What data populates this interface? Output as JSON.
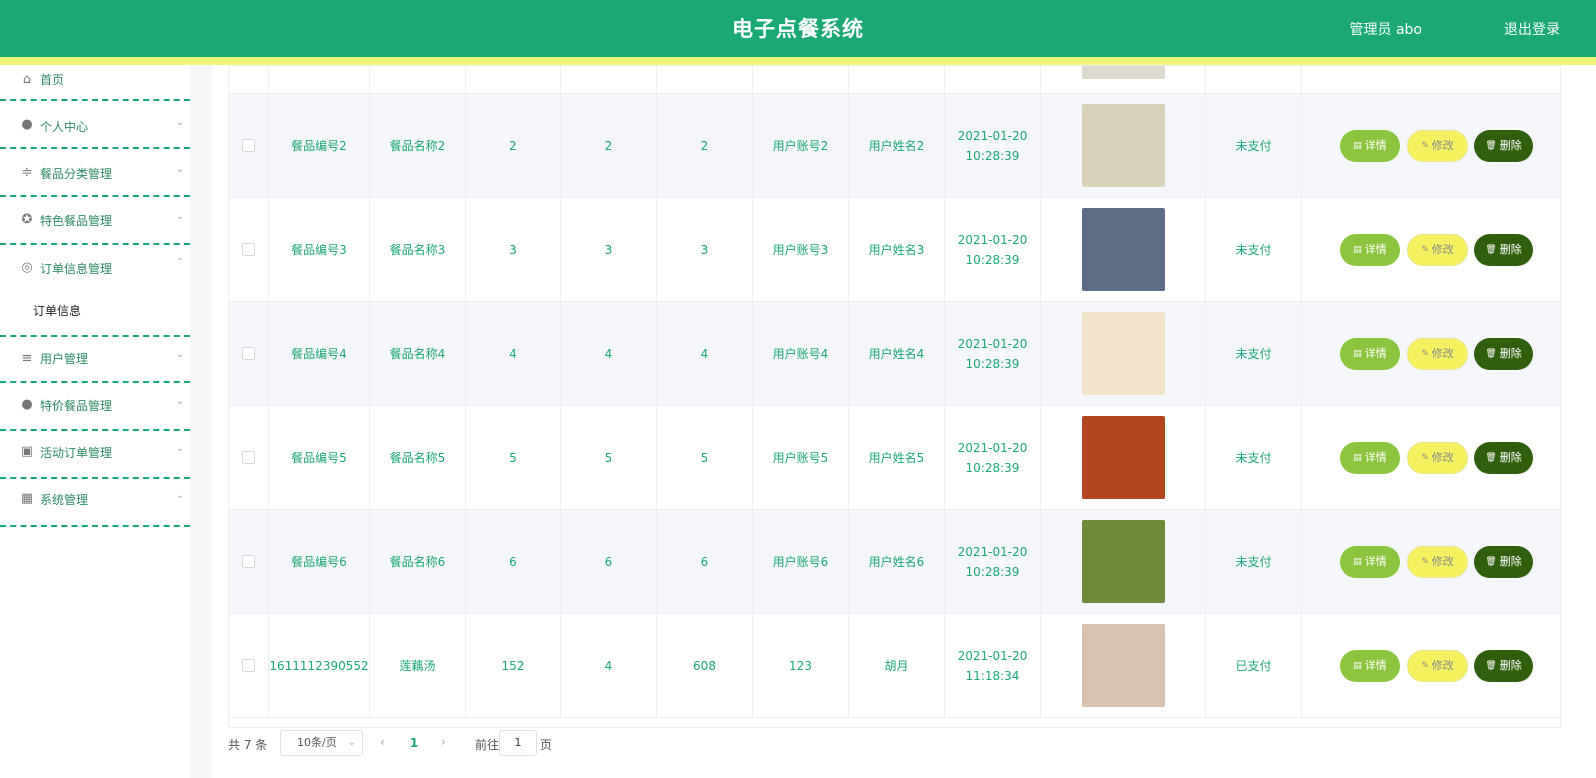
{
  "header": {
    "title": "电子点餐系统",
    "user_label": "管理员 abo",
    "logout_label": "退出登录"
  },
  "sidebar": {
    "items": [
      {
        "label": "首页",
        "icon": "home-icon"
      },
      {
        "label": "个人中心",
        "icon": "user-icon"
      },
      {
        "label": "餐品分类管理",
        "icon": "sliders-icon"
      },
      {
        "label": "特色餐品管理",
        "icon": "compass-icon"
      },
      {
        "label": "订单信息管理",
        "icon": "lifebuoy-icon"
      },
      {
        "label": "用户管理",
        "icon": "menu-icon"
      },
      {
        "label": "特价餐品管理",
        "icon": "location-icon"
      },
      {
        "label": "活动订单管理",
        "icon": "clipboard-icon"
      },
      {
        "label": "系统管理",
        "icon": "grid-icon"
      }
    ],
    "submenu": {
      "label": "订单信息"
    }
  },
  "table": {
    "rows": [
      {
        "code": "餐品编号2",
        "name": "餐品名称2",
        "price": "2",
        "qty": "2",
        "total": "2",
        "account": "用户账号2",
        "username": "用户姓名2",
        "time": "2021-01-20 10:28:39",
        "status": "未支付",
        "image": "salad plate",
        "thumb_color": "#d9d2bb"
      },
      {
        "code": "餐品编号3",
        "name": "餐品名称3",
        "price": "3",
        "qty": "3",
        "total": "3",
        "account": "用户账号3",
        "username": "用户姓名3",
        "time": "2021-01-20 10:28:39",
        "status": "未支付",
        "image": "salmon dish",
        "thumb_color": "#5c6c86"
      },
      {
        "code": "餐品编号4",
        "name": "餐品名称4",
        "price": "4",
        "qty": "4",
        "total": "4",
        "account": "用户账号4",
        "username": "用户姓名4",
        "time": "2021-01-20 10:28:39",
        "status": "未支付",
        "image": "fried egg",
        "thumb_color": "#f1e3c9"
      },
      {
        "code": "餐品编号5",
        "name": "餐品名称5",
        "price": "5",
        "qty": "5",
        "total": "5",
        "account": "用户账号5",
        "username": "用户姓名5",
        "time": "2021-01-20 10:28:39",
        "status": "未支付",
        "image": "shrimp",
        "thumb_color": "#b3461f"
      },
      {
        "code": "餐品编号6",
        "name": "餐品名称6",
        "price": "6",
        "qty": "6",
        "total": "6",
        "account": "用户账号6",
        "username": "用户姓名6",
        "time": "2021-01-20 10:28:39",
        "status": "未支付",
        "image": "skewers",
        "thumb_color": "#6e8a3a"
      },
      {
        "code": "1611112390552",
        "name": "莲藕汤",
        "price": "152",
        "qty": "4",
        "total": "608",
        "account": "123",
        "username": "胡月",
        "time": "2021-01-20 11:18:34",
        "status": "已支付",
        "image": "lotus root soup",
        "thumb_color": "#d8c1ae"
      }
    ],
    "actions": {
      "detail": "详情",
      "edit": "修改",
      "delete": "删除"
    }
  },
  "pagination": {
    "total": "共 7 条",
    "page_size": "10条/页",
    "current_page": "1",
    "goto_label": "前往",
    "goto_value": "1",
    "page_unit": "页"
  },
  "colors": {
    "primary": "#1aa874",
    "accent_strip": "#f3f77a",
    "detail_btn": "#8cc63f",
    "edit_btn": "#f6f25f",
    "delete_btn": "#2f5f0d"
  }
}
